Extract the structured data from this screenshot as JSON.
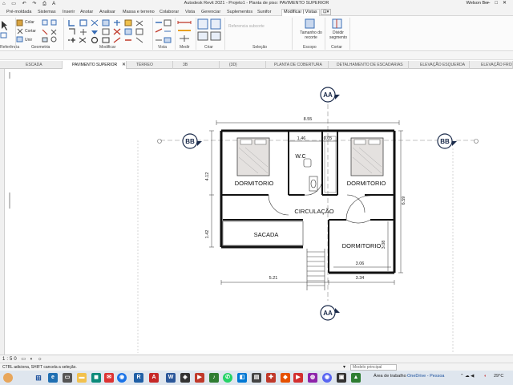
{
  "window": {
    "title": "Autodesk Revit 2021 - Projeto1 - Planta de piso: PAVIMENTO SUPERIOR",
    "user": "Welson Ber"
  },
  "ribbon": {
    "tabs": [
      "Pré-moldada",
      "Sistemas",
      "Inserir",
      "Anotar",
      "Analisar",
      "Massa e terreno",
      "Colaborar",
      "Vista",
      "Gerenciar",
      "Suplementos",
      "Sunifor",
      "Modificar | Vistas"
    ],
    "active_tab": "Modificar | Vistas",
    "panels": [
      "Referência",
      "Geometria",
      "Modificar",
      "Vista",
      "Medir",
      "Criar",
      "Seleção",
      "Escopo",
      "Cortar"
    ],
    "labels": {
      "colar": "Colar",
      "cortar": "Cortar",
      "unir": "Unir",
      "referencia_subcorte": "Referencia subcorte",
      "tamanho_recorte": "Tamanho do recorte",
      "dividir_segmento": "Dividir segmento"
    }
  },
  "view_tabs": [
    "ESCADA",
    "PAVIMENTO SUPERIOR",
    "TÉRREO",
    "3B",
    "{3D}",
    "PLANTA DE COBERTURA",
    "DETALHAMENTO DE ESCADARIAS",
    "ELEVAÇÃO ESQUERDA",
    "ELEVAÇÃO FRONT"
  ],
  "active_view": "PAVIMENTO SUPERIOR",
  "drawing": {
    "section_aa": "AA",
    "section_bb": "BB",
    "rooms": [
      "DORMITORIO",
      "W.C",
      "DORMITORIO",
      "CIRCULAÇÃO",
      "SACADA",
      "DORMITORIO"
    ],
    "dims": {
      "top_total": "8.55",
      "top_wc": "1.46",
      "top_small": "0.05",
      "left_upper": "4.12",
      "left_lower": "1.42",
      "right_total": "6.59",
      "right_lower": "3.08",
      "bottom_left": "5.21",
      "bottom_right": "3.34",
      "dorm3_width": "3.06"
    }
  },
  "status": {
    "text": "CTRL adiciona, SHIFT cancela a seleção.",
    "model": "Modelo principal"
  },
  "taskbar": {
    "apps": [
      "Área de trabalho",
      "OneDrive - Pessoa"
    ],
    "temp": "29°C",
    "colors": {
      "chrome": "#1a73e8",
      "revit": "#1f5fa6",
      "autocad": "#c62828",
      "word": "#2b579a",
      "edge": "#0b8a7a"
    }
  }
}
